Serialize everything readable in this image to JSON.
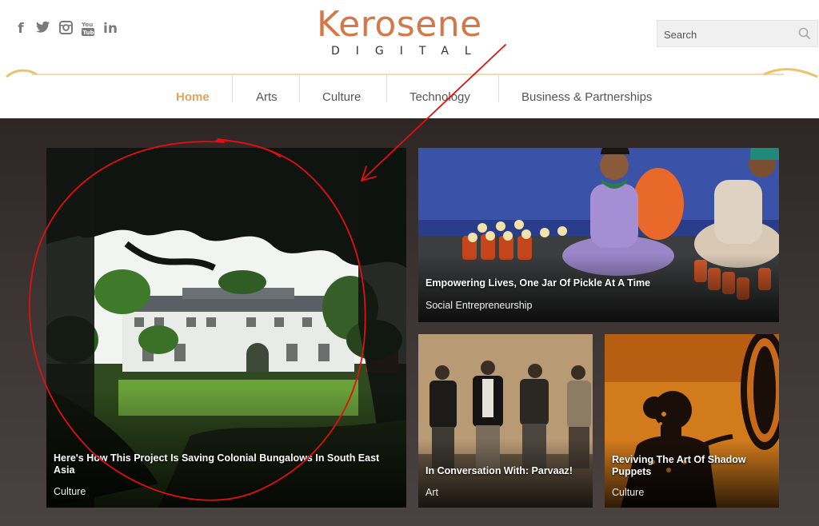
{
  "header": {
    "logo_main": "Kerosene",
    "logo_sub": "DIGITAL",
    "search_placeholder": "Search",
    "social_icons": [
      "facebook-icon",
      "twitter-icon",
      "instagram-icon",
      "youtube-icon",
      "linkedin-icon"
    ]
  },
  "nav": {
    "items": [
      {
        "label": "Home",
        "active": true
      },
      {
        "label": "Arts",
        "active": false
      },
      {
        "label": "Culture",
        "active": false
      },
      {
        "label": "Technology",
        "active": false
      },
      {
        "label": "Business & Partnerships",
        "active": false
      }
    ]
  },
  "cards": [
    {
      "title": "Here's How This Project Is Saving Colonial Bungalows In South East Asia",
      "category": "Culture"
    },
    {
      "title": "Empowering Lives, One Jar Of Pickle At A Time",
      "category": "Social Entrepreneurship"
    },
    {
      "title": "In Conversation With: Parvaaz!",
      "category": "Art"
    },
    {
      "title": "Reviving The Art Of Shadow Puppets",
      "category": "Culture"
    }
  ],
  "colors": {
    "accent_orange": "#d4784a",
    "nav_active": "#e2a45a",
    "wave_gold": "#e9c46a",
    "annotation_red": "#e01010"
  }
}
